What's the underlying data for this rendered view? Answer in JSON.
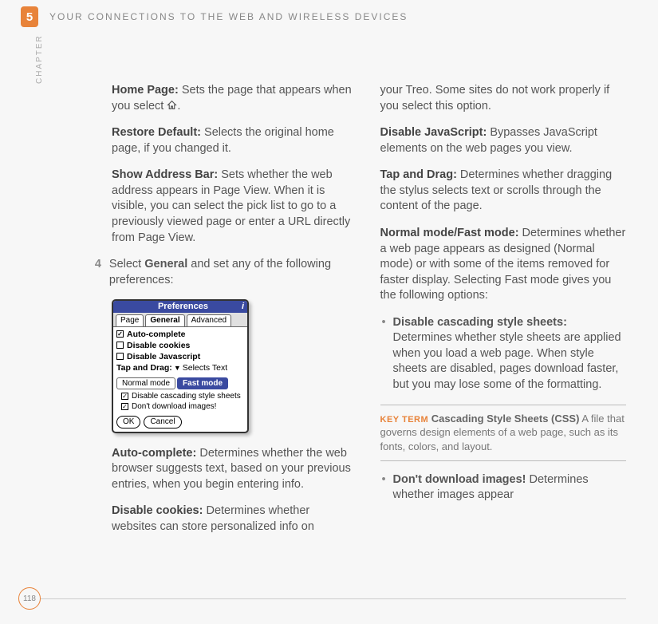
{
  "header": {
    "chapter_num": "5",
    "chapter_title": "YOUR CONNECTIONS TO THE WEB AND WIRELESS DEVICES",
    "side_label": "CHAPTER"
  },
  "page_number": "118",
  "left": {
    "home_page_label": "Home Page:",
    "home_page_text": " Sets the page that appears when you select ",
    "home_page_after": ".",
    "restore_default_label": "Restore Default:",
    "restore_default_text": " Selects the original home page, if you changed it.",
    "show_addr_label": "Show Address Bar:",
    "show_addr_text": " Sets whether the web address appears in Page View. When it is visible, you can select the pick list to go to a previously viewed page or enter a URL directly from Page View.",
    "step4_num": "4",
    "step4_text_pre": "Select ",
    "step4_bold": "General",
    "step4_text_post": " and set any of the following preferences:",
    "autocomplete_label": "Auto-complete:",
    "autocomplete_text": " Determines whether the web browser suggests text, based on your previous entries, when you begin entering info.",
    "cookies_label": "Disable cookies:",
    "cookies_text": " Determines whether websites can store personalized info on"
  },
  "prefs": {
    "title": "Preferences",
    "info_glyph": "i",
    "tabs": {
      "page": "Page",
      "general": "General",
      "advanced": "Advanced"
    },
    "auto_complete": "Auto-complete",
    "disable_cookies": "Disable cookies",
    "disable_js": "Disable Javascript",
    "tap_drag_label": "Tap and Drag:",
    "tap_drag_value": "Selects Text",
    "normal_mode": "Normal mode",
    "fast_mode": "Fast mode",
    "disable_css": "Disable cascading style sheets",
    "no_images": "Don't download images!",
    "ok": "OK",
    "cancel": "Cancel",
    "check": "✓"
  },
  "right": {
    "cont1": "your Treo. Some sites do not work properly if you select this option.",
    "djs_label": "Disable JavaScript:",
    "djs_text": " Bypasses JavaScript elements on the web pages you view.",
    "tap_label": "Tap and Drag:",
    "tap_text": " Determines whether dragging the stylus selects text or scrolls through the content of the page.",
    "mode_label": "Normal mode/Fast mode:",
    "mode_text": " Determines whether a web page appears as designed (Normal mode) or with some of the items removed for faster display. Selecting Fast mode gives you the following options:",
    "css_label": "Disable cascading style sheets:",
    "css_text": " Determines whether style sheets are applied when you load a web page. When style sheets are disabled, pages download faster, but you may lose some of the formatting.",
    "keyterm_label": "KEY TERM",
    "keyterm_term": "Cascading Style Sheets (CSS)",
    "keyterm_body": "   A file that governs design elements of a web page, such as its fonts, colors, and layout.",
    "img_label": "Don't download images!",
    "img_text": " Determines whether images appear"
  }
}
